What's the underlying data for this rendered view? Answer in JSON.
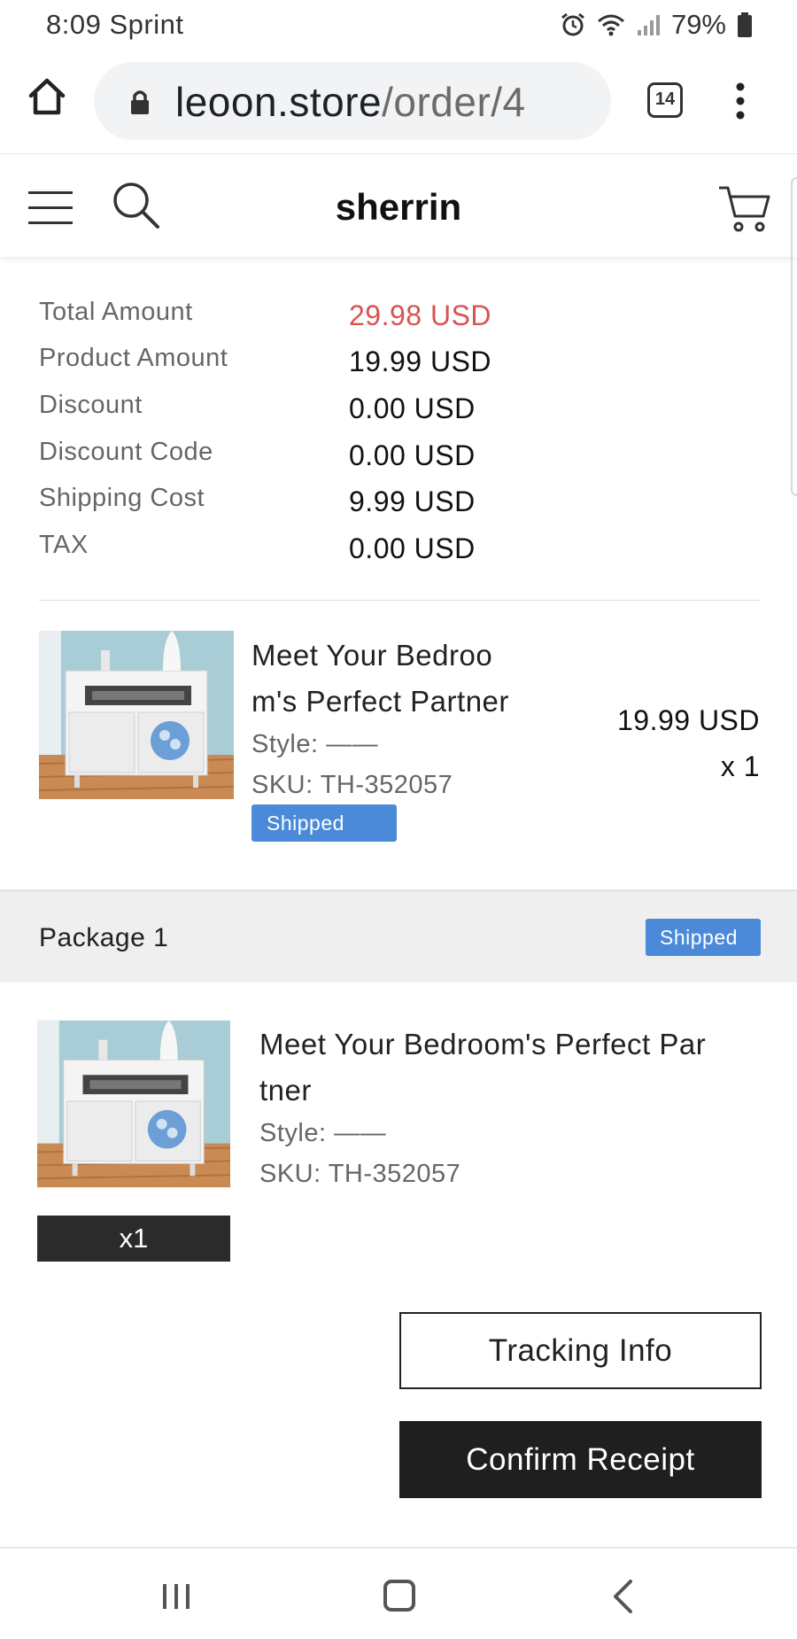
{
  "status_bar": {
    "time": "8:09",
    "carrier": "Sprint",
    "battery": "79%",
    "icons": [
      "alarm-icon",
      "wifi-icon",
      "signal-icon",
      "battery-icon"
    ]
  },
  "browser": {
    "url_domain": "leoon.store",
    "url_path": "/order/4",
    "tab_count": "14",
    "icons": [
      "home-icon",
      "lock-icon",
      "tabs-icon",
      "more-menu-icon"
    ]
  },
  "site_header": {
    "brand": "sherrin",
    "icons": [
      "hamburger-menu-icon",
      "search-icon",
      "cart-icon"
    ]
  },
  "summary": [
    {
      "label": "Total Amount",
      "value": "29.98 USD"
    },
    {
      "label": "Product Amount",
      "value": "19.99 USD"
    },
    {
      "label": "Discount",
      "value": "0.00 USD"
    },
    {
      "label": "Discount Code",
      "value": "0.00 USD"
    },
    {
      "label": "Shipping Cost",
      "value": "9.99 USD"
    },
    {
      "label": "TAX",
      "value": "0.00 USD"
    }
  ],
  "order_item": {
    "title_line1": "Meet Your Bedroo",
    "title_line2": "m's Perfect Partner",
    "style": "Style: ——",
    "sku": "SKU: TH-352057",
    "status": "Shipped",
    "price": "19.99 USD",
    "quantity": "x 1"
  },
  "package": {
    "title": "Package 1",
    "status": "Shipped",
    "item": {
      "title_line1": "Meet Your Bedroom's Perfect Par",
      "title_line2": "tner",
      "style": "Style: ——",
      "sku": "SKU: TH-352057",
      "quantity": "x1"
    },
    "tracking_button": "Tracking Info",
    "confirm_button": "Confirm Receipt"
  },
  "colors": {
    "total_price": "#d9534f",
    "badge": "#4a8ad9",
    "dark_button": "#1f1f1f"
  },
  "nav_bar": {
    "icons": [
      "recent-apps-icon",
      "home-nav-icon",
      "back-icon"
    ]
  }
}
